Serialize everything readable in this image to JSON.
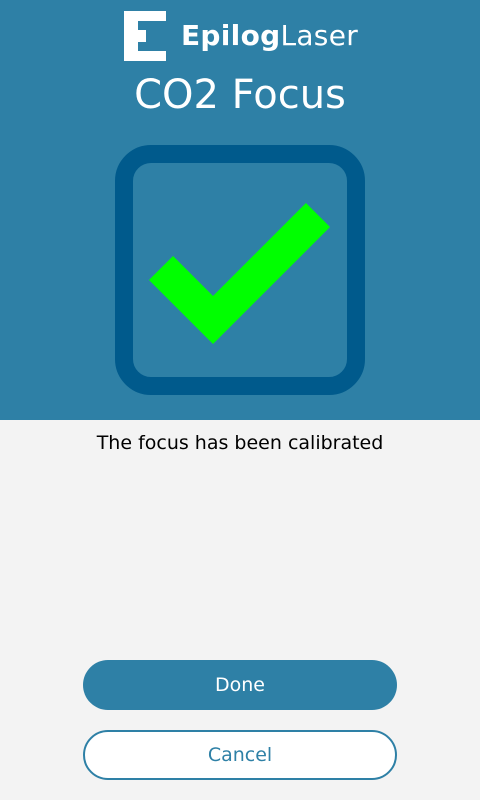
{
  "brand": {
    "wordmark_bold": "Epilog",
    "wordmark_light": "Laser",
    "logo_icon": "epilog-e-icon"
  },
  "screen": {
    "title": "CO2 Focus",
    "status_icon": "checkmark-success-icon",
    "message": "The focus has been calibrated"
  },
  "actions": {
    "done_label": "Done",
    "cancel_label": "Cancel"
  },
  "colors": {
    "header_bg": "#2e80a6",
    "check_frame": "#005a8c",
    "check_mark": "#00ff00",
    "body_bg": "#f3f3f3"
  }
}
